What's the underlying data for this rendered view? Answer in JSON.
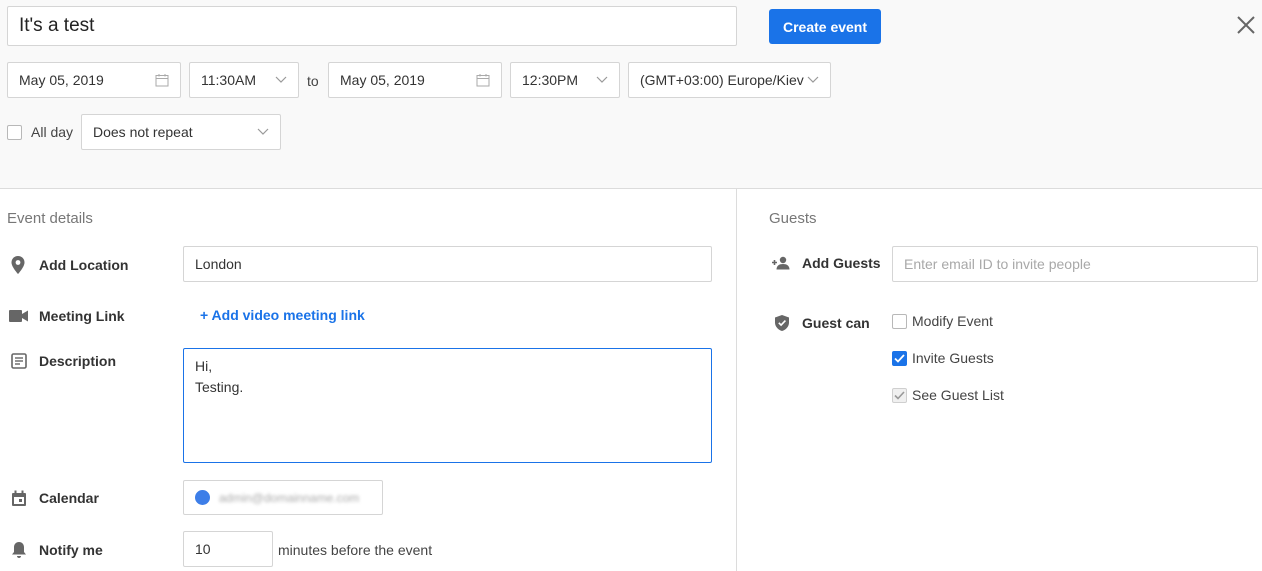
{
  "event": {
    "title": "It's a test",
    "create_label": "Create event",
    "start_date": "May 05, 2019",
    "start_time": "11:30AM",
    "to_label": "to",
    "end_date": "May 05, 2019",
    "end_time": "12:30PM",
    "timezone": "(GMT+03:00) Europe/Kiev",
    "all_day_label": "All day",
    "repeat": "Does not repeat"
  },
  "details": {
    "section_title": "Event details",
    "location_label": "Add Location",
    "location_value": "London",
    "meeting_label": "Meeting Link",
    "meeting_link_text": "+ Add video meeting link",
    "description_label": "Description",
    "description_line1": "Hi,",
    "description_line2": "Testing.",
    "calendar_label": "Calendar",
    "calendar_value": "admin@domainname.com",
    "notify_label": "Notify me",
    "notify_minutes": "10",
    "notify_suffix": "minutes before the event"
  },
  "guests": {
    "section_title": "Guests",
    "add_label": "Add Guests",
    "add_placeholder": "Enter email ID to invite people",
    "can_label": "Guest can",
    "options": [
      {
        "label": "Modify Event",
        "checked": false
      },
      {
        "label": "Invite Guests",
        "checked": true
      },
      {
        "label": "See Guest List",
        "checked": true,
        "disabled": true
      }
    ]
  },
  "colors": {
    "accent": "#1a73e8",
    "calendar": "#3d7ee8"
  }
}
